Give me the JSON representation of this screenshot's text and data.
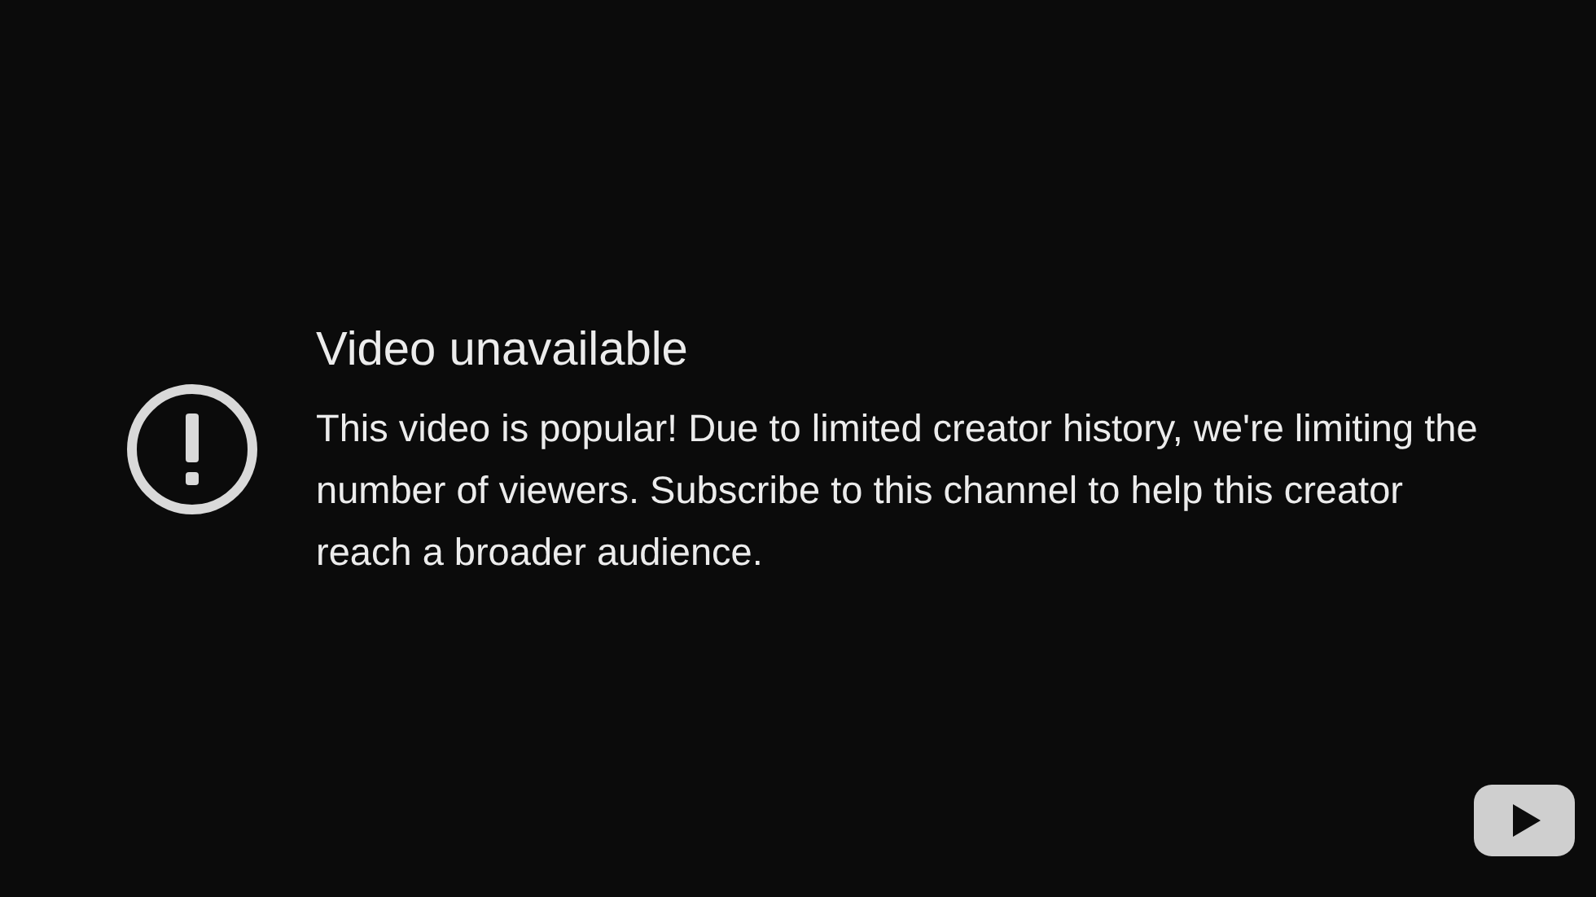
{
  "error": {
    "title": "Video unavailable",
    "message": "This video is popular! Due to limited creator history, we're limiting the number of viewers. Subscribe to this channel to help this creator reach a broader audience."
  }
}
